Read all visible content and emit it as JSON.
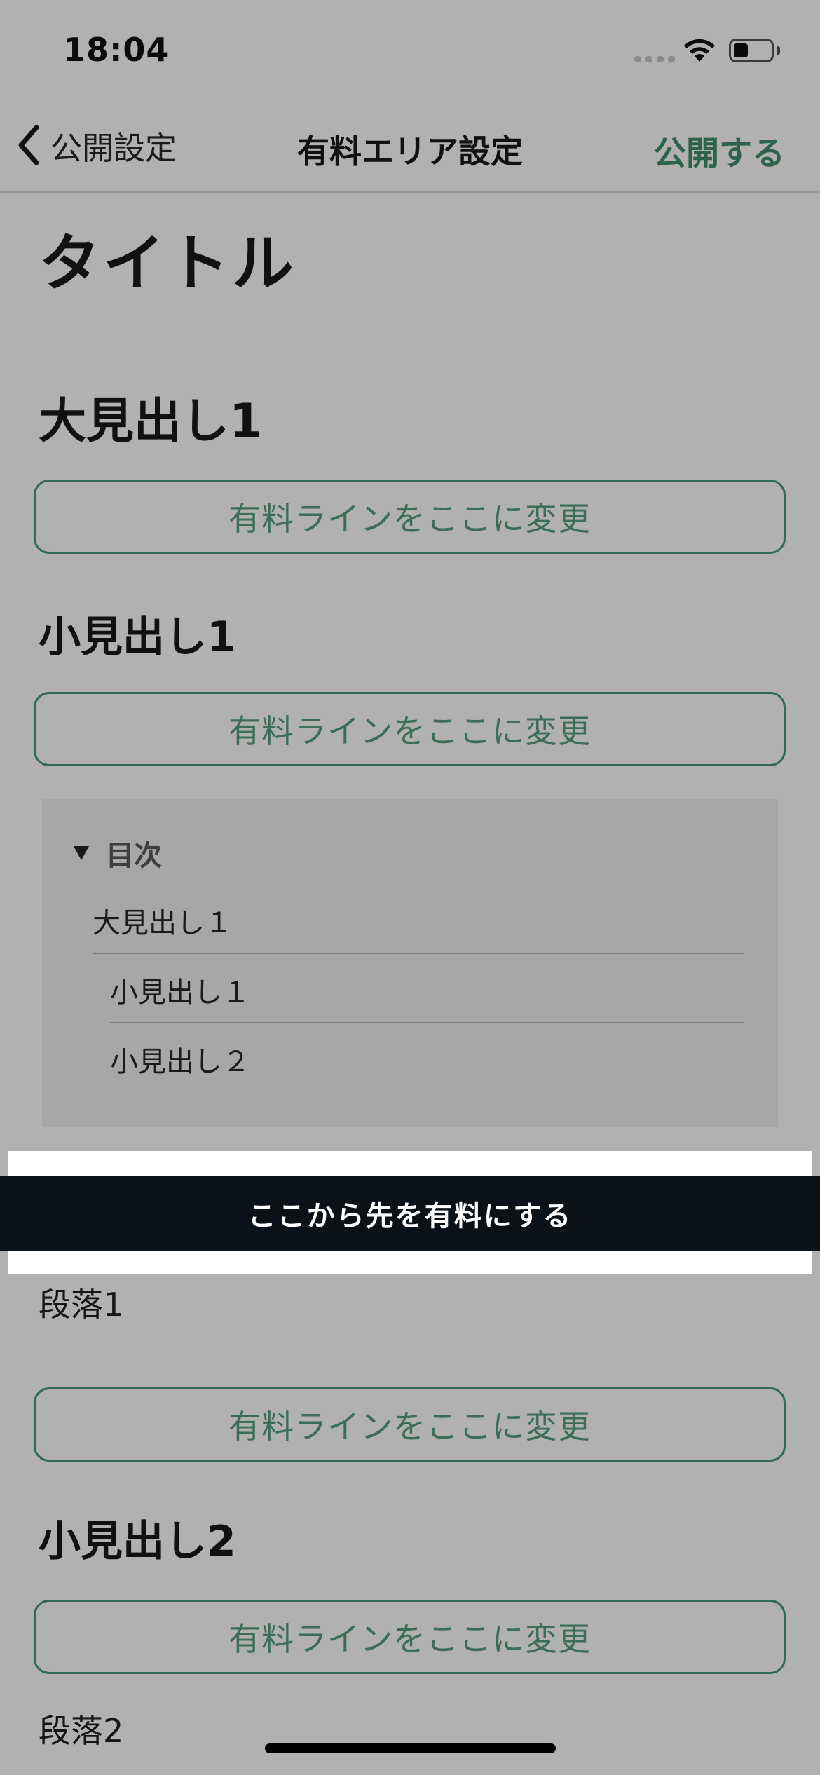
{
  "status_bar": {
    "time": "18:04"
  },
  "nav": {
    "back_label": "公開設定",
    "title": "有料エリア設定",
    "publish_label": "公開する"
  },
  "content": {
    "title": "タイトル",
    "heading_large_1": "大見出し1",
    "change_line_label": "有料ラインをここに変更",
    "heading_small_1": "小見出し1",
    "toc": {
      "label": "目次",
      "items": [
        "大見出し１",
        "小見出し１",
        "小見出し２"
      ]
    },
    "paid_banner_label": "ここから先を有料にする",
    "paragraph_1": "段落1",
    "heading_small_2": "小見出し2",
    "paragraph_2": "段落2"
  },
  "colors": {
    "accent": "#2f6a51",
    "background": "#b1b1b1",
    "banner": "#0b1118"
  }
}
